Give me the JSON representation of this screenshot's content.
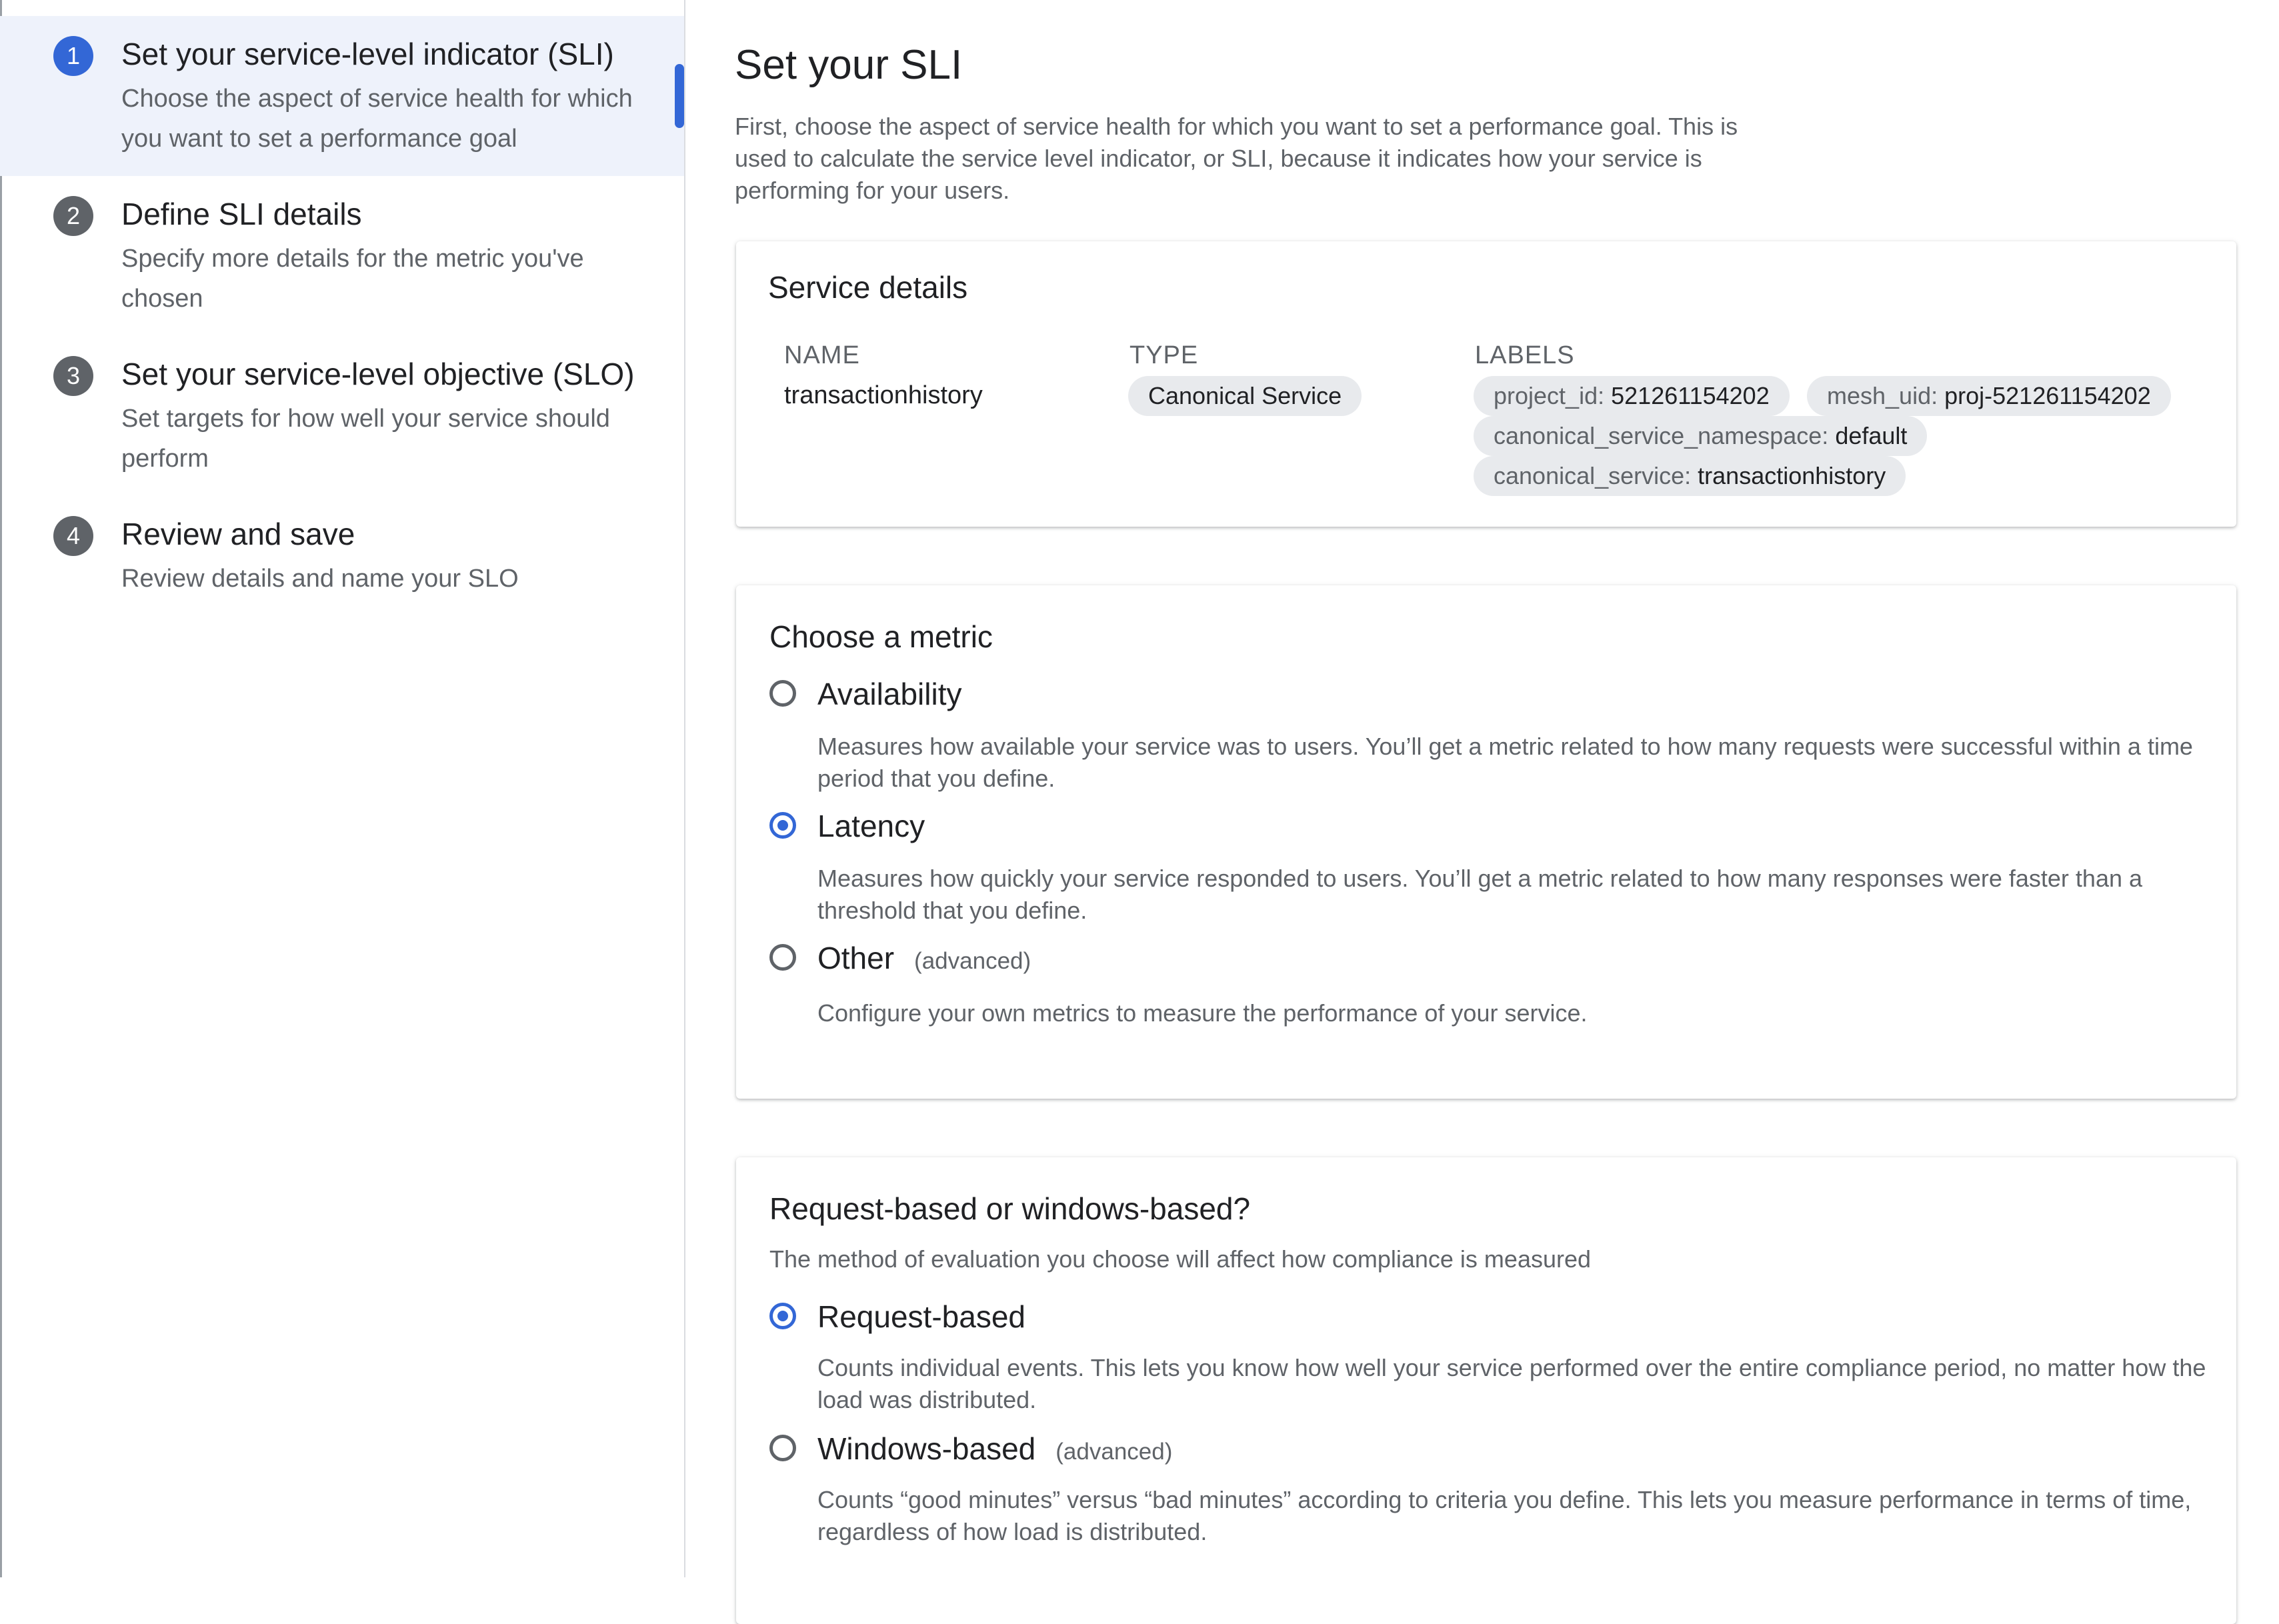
{
  "stepper": {
    "steps": [
      {
        "number": "1",
        "title": "Set your service-level indicator (SLI)",
        "description": "Choose the aspect of service health for which you want to set a performance goal"
      },
      {
        "number": "2",
        "title": "Define SLI details",
        "description": "Specify more details for the metric you've chosen"
      },
      {
        "number": "3",
        "title": "Set your service-level objective (SLO)",
        "description": "Set targets for how well your service should perform"
      },
      {
        "number": "4",
        "title": "Review and save",
        "description": "Review details and name your SLO"
      }
    ],
    "active_step": 1
  },
  "main": {
    "title": "Set your SLI",
    "intro": "First, choose the aspect of service health for which you want to set a performance goal. This is used to calculate the service level indicator, or SLI, because it indicates how your service is performing for your users."
  },
  "service_details": {
    "title": "Service details",
    "name_header": "NAME",
    "type_header": "TYPE",
    "labels_header": "LABELS",
    "name": "transactionhistory",
    "type": "Canonical Service",
    "labels": [
      {
        "key": "project_id:",
        "value": "521261154202"
      },
      {
        "key": "mesh_uid:",
        "value": "proj-521261154202"
      },
      {
        "key": "canonical_service_namespace:",
        "value": "default"
      },
      {
        "key": "canonical_service:",
        "value": "transactionhistory"
      }
    ]
  },
  "metric": {
    "title": "Choose a metric",
    "options": [
      {
        "label": "Availability",
        "advanced": "",
        "description": "Measures how available your service was to users. You’ll get a metric related to how many requests were successful within a time period that you define.",
        "selected": false
      },
      {
        "label": "Latency",
        "advanced": "",
        "description": "Measures how quickly your service responded to users. You’ll get a metric related to how many responses were faster than a threshold that you define.",
        "selected": true
      },
      {
        "label": "Other",
        "advanced": "(advanced)",
        "description": "Configure your own metrics to measure the performance of your service.",
        "selected": false
      }
    ]
  },
  "evaluation": {
    "title": "Request-based or windows-based?",
    "description": "The method of evaluation you choose will affect how compliance is measured",
    "options": [
      {
        "label": "Request-based",
        "advanced": "",
        "description": "Counts individual events. This lets you know how well your service performed over the entire compliance period, no matter how the load was distributed.",
        "selected": true
      },
      {
        "label": "Windows-based",
        "advanced": "(advanced)",
        "description": "Counts “good minutes” versus “bad minutes” according to criteria you define. This lets you measure performance in terms of time, regardless of how load is distributed.",
        "selected": false
      }
    ]
  },
  "colors": {
    "accent": "#3367d6",
    "active_step_bg": "#eef2fb",
    "chip_bg": "#e8eaed",
    "muted_text": "#5f6368"
  }
}
